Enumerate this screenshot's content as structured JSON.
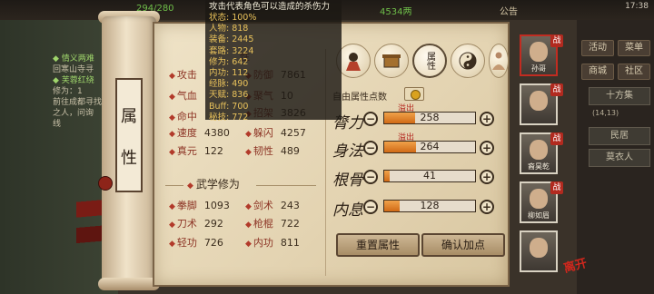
{
  "background": {
    "stat_left": "294/280",
    "stat_right": "4534两",
    "notice": "公告",
    "clock": "17:38",
    "quests": [
      {
        "text": "◆ 情义两难",
        "highlight": true
      },
      {
        "text": "回寒山寺寻",
        "highlight": false
      },
      {
        "text": "◆ 芙蓉红绕",
        "highlight": true
      },
      {
        "text": "修为：1",
        "highlight": false
      },
      {
        "text": "前往成都寻找",
        "highlight": false
      },
      {
        "text": "之人，问询",
        "highlight": false
      },
      {
        "text": "线",
        "highlight": false
      }
    ],
    "side_buttons": [
      "活动",
      "菜单",
      "商城",
      "社区"
    ],
    "side_panels": [
      "十方集",
      "民居",
      "莫衣人"
    ],
    "side_small": "(14,13)"
  },
  "scroll": {
    "label_chars": [
      "属",
      "性"
    ]
  },
  "stats": {
    "left": [
      {
        "label": "攻击",
        "value": ""
      },
      {
        "label": "气血",
        "value": ""
      },
      {
        "label": "命中",
        "value": ""
      },
      {
        "label": "速度",
        "value": "4380"
      },
      {
        "label": "真元",
        "value": "122"
      }
    ],
    "right": [
      {
        "label": "防御",
        "value": "7861"
      },
      {
        "label": "聚气",
        "value": "10"
      },
      {
        "label": "招架",
        "value": "3826"
      },
      {
        "label": "躲闪",
        "value": "4257"
      },
      {
        "label": "韧性",
        "value": "489"
      }
    ],
    "partial_label": "性"
  },
  "martial": {
    "title": "武学修为",
    "left": [
      {
        "label": "拳脚",
        "value": "1093"
      },
      {
        "label": "刀术",
        "value": "292"
      },
      {
        "label": "轻功",
        "value": "726"
      }
    ],
    "right": [
      {
        "label": "剑术",
        "value": "243"
      },
      {
        "label": "枪棍",
        "value": "722"
      },
      {
        "label": "内功",
        "value": "811"
      }
    ]
  },
  "attributes": {
    "tabs": [
      {
        "icon": "warrior-icon",
        "label": ""
      },
      {
        "icon": "scroll-chest-icon",
        "label": ""
      },
      {
        "icon": "attribute-tab-icon",
        "label": "属性"
      },
      {
        "icon": "taiji-icon",
        "label": ""
      },
      {
        "icon": "meditate-icon",
        "label": ""
      }
    ],
    "free_points_label": "自由属性点数",
    "free_points_value": 0,
    "rows": [
      {
        "name": "膂力",
        "value": "258",
        "fill": 0.34,
        "overflow": "溢出"
      },
      {
        "name": "身法",
        "value": "264",
        "fill": 0.35,
        "overflow": "溢出"
      },
      {
        "name": "根骨",
        "value": "41",
        "fill": 0.06,
        "overflow": ""
      },
      {
        "name": "内息",
        "value": "128",
        "fill": 0.17,
        "overflow": ""
      }
    ],
    "reset_label": "重置属性",
    "confirm_label": "确认加点"
  },
  "tooltip": {
    "title": "攻击代表角色可以造成的杀伤力",
    "rows": [
      "状态: 100%",
      "人物: 818",
      "装备: 2445",
      "套路: 3224",
      "修为: 642",
      "内功: 112",
      "经脉: 490",
      "天赋: 836",
      "Buff: 700",
      "秘技: 772"
    ]
  },
  "party": [
    {
      "name": "孙哥",
      "selected": true
    },
    {
      "name": "",
      "selected": false
    },
    {
      "name": "裔昊乾",
      "selected": false
    },
    {
      "name": "柳如眉",
      "selected": false
    },
    {
      "name": "",
      "selected": false
    }
  ],
  "party_badge": "战",
  "logo_text": "离开",
  "colors": {
    "parchment": "#efe3c7",
    "label_red": "#8c3324",
    "bar_orange": "#d06a16",
    "overflow_red": "#b3261e",
    "tooltip_gold": "#e9c25b"
  }
}
